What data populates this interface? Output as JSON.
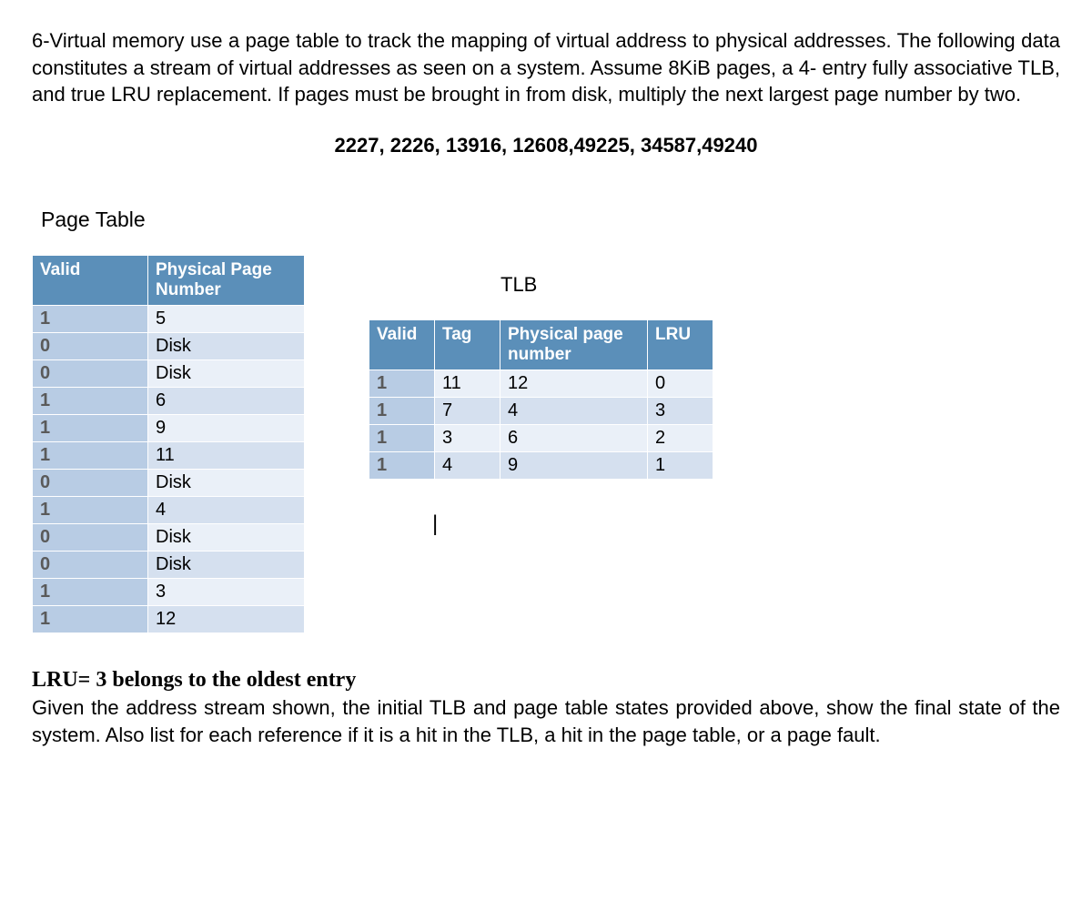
{
  "question": {
    "intro": "6-Virtual memory use a page table to track the mapping of virtual address to physical addresses. The following data constitutes a stream of virtual addresses as seen on a system. Assume 8KiB pages, a 4- entry fully associative TLB, and true LRU replacement. If pages must be brought in from disk, multiply the next largest page number by two.",
    "address_stream": "2227, 2226, 13916, 12608,49225, 34587,49240",
    "pt_section_label": "Page Table",
    "tlb_label": "TLB",
    "footer_bold": "LRU= 3 belongs to the oldest entry",
    "footer_rest": "Given the address stream shown, the initial TLB and page table states provided above, show the final state of the system. Also list for each reference if it is a hit in the TLB, a hit in the page table, or a page fault."
  },
  "page_table": {
    "headers": {
      "valid": "Valid",
      "ppn": "Physical Page Number"
    },
    "rows": [
      {
        "valid": "1",
        "ppn": "5"
      },
      {
        "valid": "0",
        "ppn": "Disk"
      },
      {
        "valid": "0",
        "ppn": "Disk"
      },
      {
        "valid": "1",
        "ppn": "6"
      },
      {
        "valid": "1",
        "ppn": "9"
      },
      {
        "valid": "1",
        "ppn": "11"
      },
      {
        "valid": "0",
        "ppn": "Disk"
      },
      {
        "valid": "1",
        "ppn": "4"
      },
      {
        "valid": "0",
        "ppn": "Disk"
      },
      {
        "valid": "0",
        "ppn": "Disk"
      },
      {
        "valid": "1",
        "ppn": "3"
      },
      {
        "valid": "1",
        "ppn": "12"
      }
    ]
  },
  "tlb": {
    "headers": {
      "valid": "Valid",
      "tag": "Tag",
      "ppn": "Physical page number",
      "lru": "LRU"
    },
    "rows": [
      {
        "valid": "1",
        "tag": "11",
        "ppn": "12",
        "lru": "0"
      },
      {
        "valid": "1",
        "tag": "7",
        "ppn": "4",
        "lru": "3"
      },
      {
        "valid": "1",
        "tag": "3",
        "ppn": "6",
        "lru": "2"
      },
      {
        "valid": "1",
        "tag": "4",
        "ppn": "9",
        "lru": "1"
      }
    ]
  },
  "chart_data": {
    "type": "table",
    "tables": [
      {
        "name": "Page Table",
        "columns": [
          "Valid",
          "Physical Page Number"
        ],
        "rows": [
          [
            "1",
            "5"
          ],
          [
            "0",
            "Disk"
          ],
          [
            "0",
            "Disk"
          ],
          [
            "1",
            "6"
          ],
          [
            "1",
            "9"
          ],
          [
            "1",
            "11"
          ],
          [
            "0",
            "Disk"
          ],
          [
            "1",
            "4"
          ],
          [
            "0",
            "Disk"
          ],
          [
            "0",
            "Disk"
          ],
          [
            "1",
            "3"
          ],
          [
            "1",
            "12"
          ]
        ]
      },
      {
        "name": "TLB",
        "columns": [
          "Valid",
          "Tag",
          "Physical page number",
          "LRU"
        ],
        "rows": [
          [
            "1",
            "11",
            "12",
            "0"
          ],
          [
            "1",
            "7",
            "4",
            "3"
          ],
          [
            "1",
            "3",
            "6",
            "2"
          ],
          [
            "1",
            "4",
            "9",
            "1"
          ]
        ]
      }
    ]
  }
}
